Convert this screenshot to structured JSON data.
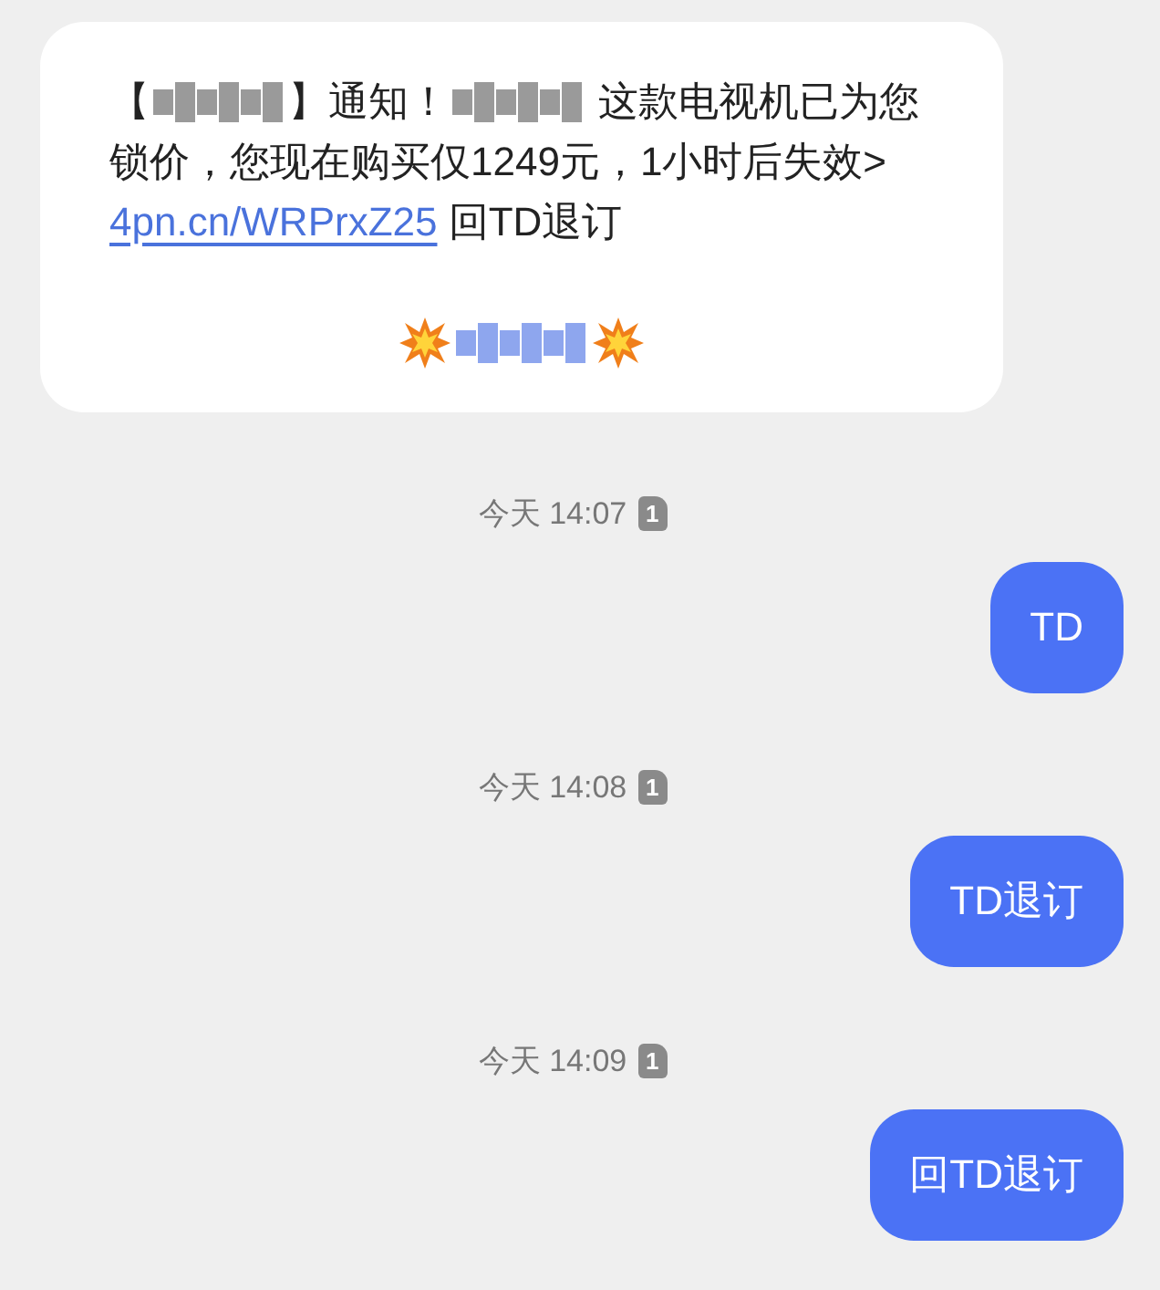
{
  "received": {
    "lines": [
      [
        {
          "kind": "text",
          "text": "【"
        },
        {
          "kind": "redacted",
          "color": "#9a9a9a"
        },
        {
          "kind": "text",
          "text": "】通知！"
        },
        {
          "kind": "redacted",
          "color": "#9a9a9a"
        },
        {
          "kind": "text",
          "text": " 这款电视机已为您"
        }
      ],
      [
        {
          "kind": "text",
          "text": "锁价，您现在购买仅1249元，1小时后失效>"
        }
      ],
      [
        {
          "kind": "link",
          "text": "4pn.cn/WRPrxZ25"
        },
        {
          "kind": "text",
          "text": " 回TD退订"
        }
      ],
      [
        {
          "kind": "burst"
        },
        {
          "kind": "redacted",
          "color": "#8ea6ee"
        },
        {
          "kind": "burst"
        }
      ]
    ]
  },
  "thread": [
    {
      "time": "今天 14:07",
      "sim": "1",
      "reply": "TD"
    },
    {
      "time": "今天 14:08",
      "sim": "1",
      "reply": "TD退订"
    },
    {
      "time": "今天 14:09",
      "sim": "1",
      "reply": "回TD退订"
    }
  ]
}
